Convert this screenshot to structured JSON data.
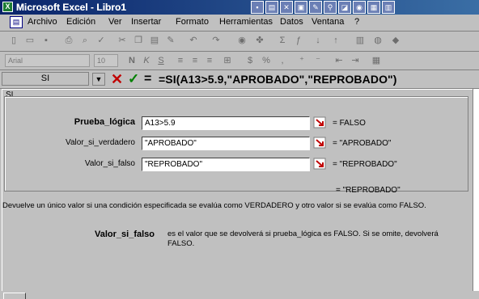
{
  "window": {
    "title": "Microsoft Excel - Libro1",
    "app_icon": "excel-icon"
  },
  "menubar": {
    "doc_icon": "workbook-icon",
    "items": [
      "Archivo",
      "Edición",
      "Ver",
      "Insertar",
      "Formato",
      "Herramientas",
      "Datos",
      "Ventana",
      "?"
    ]
  },
  "format_toolbar": {
    "font": "Arial",
    "size": "10"
  },
  "formula_bar": {
    "name_box": "SI",
    "cancel_label": "✕",
    "enter_label": "✓",
    "equals_label": "=",
    "formula": "=SI(A13>5.9,\"APROBADO\",\"REPROBADO\")"
  },
  "dialog": {
    "function_name": "SI",
    "arguments": [
      {
        "label": "Prueba_lógica",
        "value": "A13>5.9",
        "result": "= FALSO",
        "bold": true
      },
      {
        "label": "Valor_si_verdadero",
        "value": "\"APROBADO\"",
        "result": "= \"APROBADO\"",
        "bold": false
      },
      {
        "label": "Valor_si_falso",
        "value": "\"REPROBADO\"",
        "result": "= \"REPROBADO\"",
        "bold": false
      }
    ],
    "overall_result": "= \"REPROBADO\"",
    "description": "Devuelve un único valor si una condición especificada se evalúa como VERDADERO y otro valor si se evalúa como FALSO.",
    "arg_help_name": "Valor_si_falso",
    "arg_help_text": "es el valor que se devolverá si prueba_lógica es FALSO. Si se omite, devolverá FALSO."
  },
  "colors": {
    "titlebar_start": "#0a246a",
    "titlebar_end": "#3a6ea5",
    "cancel": "#c00000",
    "accept": "#008000",
    "chrome": "#c0c0c0"
  }
}
